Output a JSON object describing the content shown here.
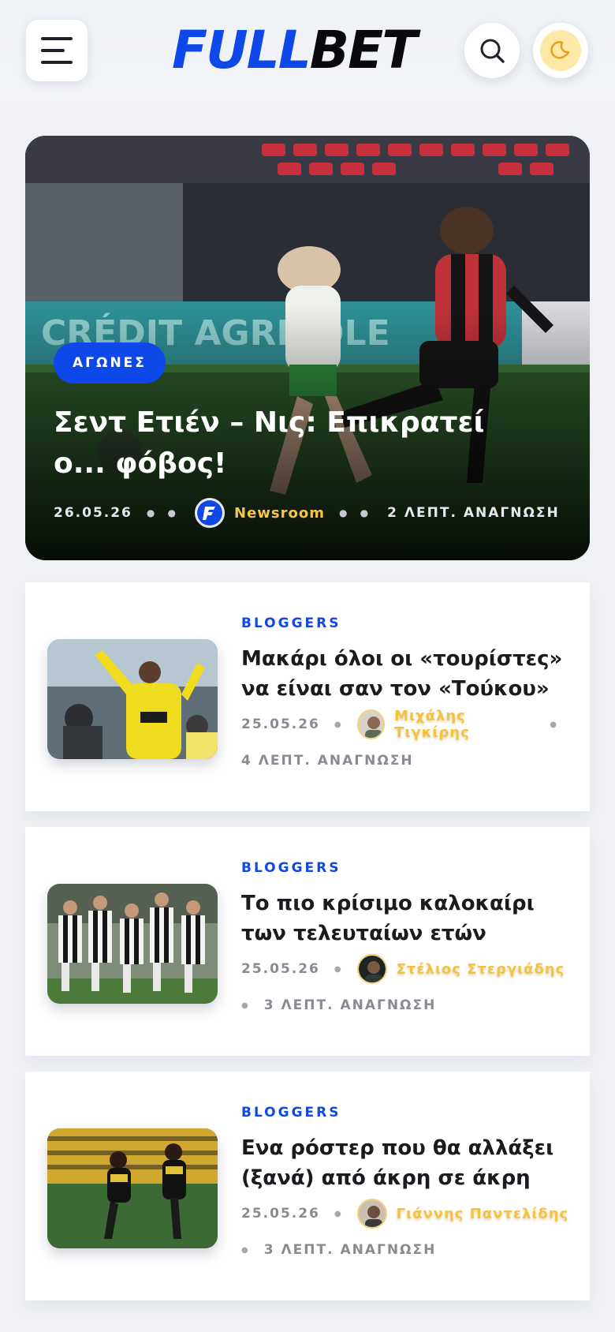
{
  "header": {
    "logo_part1": "FULL",
    "logo_part2": "BET",
    "menu_icon": "hamburger-icon",
    "search_icon": "search-icon",
    "theme_icon": "moon-icon",
    "accent_color": "#0f48e8"
  },
  "hero": {
    "category": "ΑΓΩΝΕΣ",
    "title": "Σεντ Ετιέν – Νις: Επικρατεί ο... φόβος!",
    "date": "26.05.26",
    "author": "Newsroom",
    "read_time": "2 ΛΕΠΤ. ΑΝΑΓΝΩΣΗ"
  },
  "articles": [
    {
      "category": "BLOGGERS",
      "title": "Μακάρι όλοι οι «τουρίστες» να είναι σαν τον «Τούκου»",
      "date": "25.05.26",
      "author": "Μιχάλης Τιγκίρης",
      "read_time": "4 ΛΕΠΤ. ΑΝΑΓΝΩΣΗ"
    },
    {
      "category": "BLOGGERS",
      "title": "Το πιο κρίσιμο καλοκαίρι των τελευταίων ετών",
      "date": "25.05.26",
      "author": "Στέλιος Στεργιάδης",
      "read_time": "3 ΛΕΠΤ. ΑΝΑΓΝΩΣΗ"
    },
    {
      "category": "BLOGGERS",
      "title": "Ενα ρόστερ που θα αλλάξει (ξανά) από άκρη σε άκρη",
      "date": "25.05.26",
      "author": "Γιάννης Παντελίδης",
      "read_time": "3 ΛΕΠΤ. ΑΝΑΓΝΩΣΗ"
    }
  ]
}
